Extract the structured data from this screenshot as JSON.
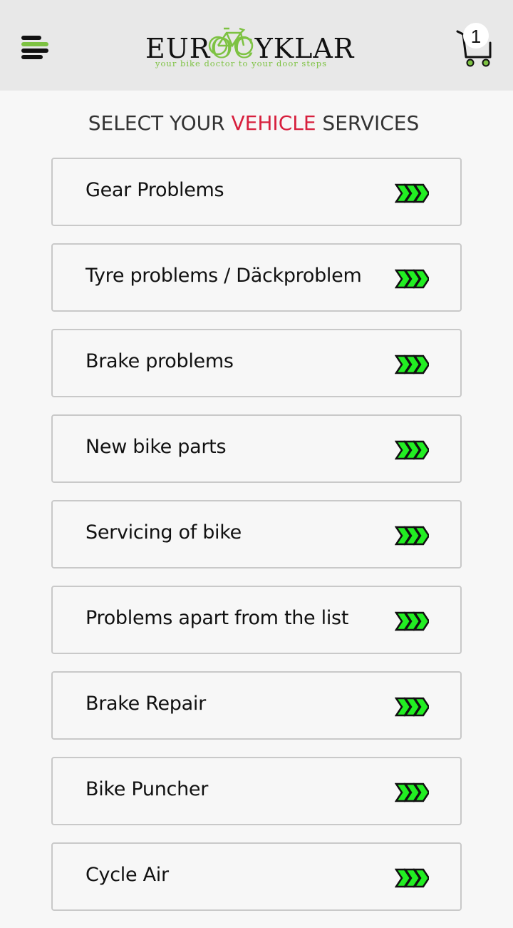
{
  "header": {
    "logo": {
      "text_before": "EUR",
      "text_o": "O",
      "text_c": "C",
      "text_after": "YKLAR",
      "tagline": "your bike doctor to your door steps"
    },
    "menu_icon": "hamburger-menu-icon",
    "cart_icon": "shopping-cart-icon",
    "cart_count": "1"
  },
  "page": {
    "title_before": "SELECT YOUR ",
    "title_accent": "VEHICLE",
    "title_after": " SERVICES"
  },
  "services": [
    {
      "label": "Gear Problems"
    },
    {
      "label": "Tyre problems / Däckproblem"
    },
    {
      "label": "Brake problems"
    },
    {
      "label": "New bike parts"
    },
    {
      "label": "Servicing of bike"
    },
    {
      "label": "Problems apart from the list"
    },
    {
      "label": "Brake Repair"
    },
    {
      "label": "Bike Puncher"
    },
    {
      "label": "Cycle Air"
    }
  ],
  "colors": {
    "header_bg": "#e8e8e8",
    "accent_green": "#7dc242",
    "accent_red": "#d71f3d",
    "arrow_green": "#22ee22"
  }
}
